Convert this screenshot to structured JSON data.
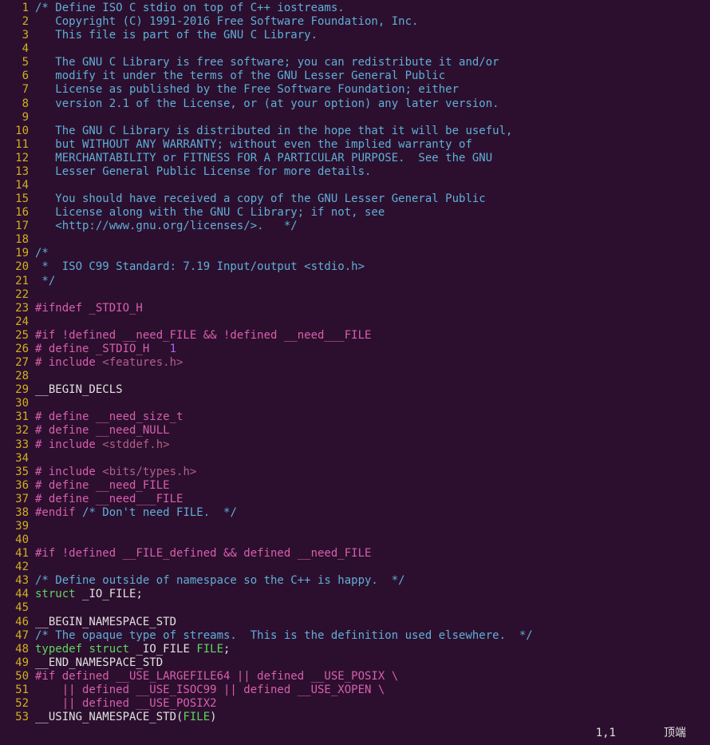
{
  "status": {
    "pos": "1,1",
    "mode": "顶端"
  },
  "lines": [
    {
      "n": 1,
      "segs": [
        [
          "c-comment",
          "/* Define ISO C stdio on top of C++ iostreams."
        ]
      ]
    },
    {
      "n": 2,
      "segs": [
        [
          "c-comment",
          "   Copyright (C) 1991-2016 Free Software Foundation, Inc."
        ]
      ]
    },
    {
      "n": 3,
      "segs": [
        [
          "c-comment",
          "   This file is part of the GNU C Library."
        ]
      ]
    },
    {
      "n": 4,
      "segs": [
        [
          "",
          ""
        ]
      ]
    },
    {
      "n": 5,
      "segs": [
        [
          "c-comment",
          "   The GNU C Library is free software; you can redistribute it and/or"
        ]
      ]
    },
    {
      "n": 6,
      "segs": [
        [
          "c-comment",
          "   modify it under the terms of the GNU Lesser General Public"
        ]
      ]
    },
    {
      "n": 7,
      "segs": [
        [
          "c-comment",
          "   License as published by the Free Software Foundation; either"
        ]
      ]
    },
    {
      "n": 8,
      "segs": [
        [
          "c-comment",
          "   version 2.1 of the License, or (at your option) any later version."
        ]
      ]
    },
    {
      "n": 9,
      "segs": [
        [
          "",
          ""
        ]
      ]
    },
    {
      "n": 10,
      "segs": [
        [
          "c-comment",
          "   The GNU C Library is distributed in the hope that it will be useful,"
        ]
      ]
    },
    {
      "n": 11,
      "segs": [
        [
          "c-comment",
          "   but WITHOUT ANY WARRANTY; without even the implied warranty of"
        ]
      ]
    },
    {
      "n": 12,
      "segs": [
        [
          "c-comment",
          "   MERCHANTABILITY or FITNESS FOR A PARTICULAR PURPOSE.  See the GNU"
        ]
      ]
    },
    {
      "n": 13,
      "segs": [
        [
          "c-comment",
          "   Lesser General Public License for more details."
        ]
      ]
    },
    {
      "n": 14,
      "segs": [
        [
          "",
          ""
        ]
      ]
    },
    {
      "n": 15,
      "segs": [
        [
          "c-comment",
          "   You should have received a copy of the GNU Lesser General Public"
        ]
      ]
    },
    {
      "n": 16,
      "segs": [
        [
          "c-comment",
          "   License along with the GNU C Library; if not, see"
        ]
      ]
    },
    {
      "n": 17,
      "segs": [
        [
          "c-comment",
          "   <http://www.gnu.org/licenses/>.   */"
        ]
      ]
    },
    {
      "n": 18,
      "segs": [
        [
          "",
          ""
        ]
      ]
    },
    {
      "n": 19,
      "segs": [
        [
          "c-comment",
          "/*"
        ]
      ]
    },
    {
      "n": 20,
      "segs": [
        [
          "c-comment",
          " *  ISO C99 Standard: 7.19 Input/output <stdio.h>"
        ]
      ]
    },
    {
      "n": 21,
      "segs": [
        [
          "c-comment",
          " */"
        ]
      ]
    },
    {
      "n": 22,
      "segs": [
        [
          "",
          ""
        ]
      ]
    },
    {
      "n": 23,
      "segs": [
        [
          "c-preproc",
          "#ifndef _STDIO_H"
        ]
      ]
    },
    {
      "n": 24,
      "segs": [
        [
          "",
          ""
        ]
      ]
    },
    {
      "n": 25,
      "segs": [
        [
          "c-preproc",
          "#if !defined __need_FILE && !defined __need___FILE"
        ]
      ]
    },
    {
      "n": 26,
      "segs": [
        [
          "c-preproc",
          "# define _STDIO_H   "
        ],
        [
          "c-number",
          "1"
        ]
      ]
    },
    {
      "n": 27,
      "segs": [
        [
          "c-preproc",
          "# include "
        ],
        [
          "c-include",
          "<features.h>"
        ]
      ]
    },
    {
      "n": 28,
      "segs": [
        [
          "",
          ""
        ]
      ]
    },
    {
      "n": 29,
      "segs": [
        [
          "c-ident",
          "__BEGIN_DECLS"
        ]
      ]
    },
    {
      "n": 30,
      "segs": [
        [
          "",
          ""
        ]
      ]
    },
    {
      "n": 31,
      "segs": [
        [
          "c-preproc",
          "# define __need_size_t"
        ]
      ]
    },
    {
      "n": 32,
      "segs": [
        [
          "c-preproc",
          "# define __need_NULL"
        ]
      ]
    },
    {
      "n": 33,
      "segs": [
        [
          "c-preproc",
          "# include "
        ],
        [
          "c-include",
          "<stddef.h>"
        ]
      ]
    },
    {
      "n": 34,
      "segs": [
        [
          "",
          ""
        ]
      ]
    },
    {
      "n": 35,
      "segs": [
        [
          "c-preproc",
          "# include "
        ],
        [
          "c-include",
          "<bits/types.h>"
        ]
      ]
    },
    {
      "n": 36,
      "segs": [
        [
          "c-preproc",
          "# define __need_FILE"
        ]
      ]
    },
    {
      "n": 37,
      "segs": [
        [
          "c-preproc",
          "# define __need___FILE"
        ]
      ]
    },
    {
      "n": 38,
      "segs": [
        [
          "c-preproc",
          "#endif "
        ],
        [
          "c-comment",
          "/* Don't need FILE.  */"
        ]
      ]
    },
    {
      "n": 39,
      "segs": [
        [
          "",
          ""
        ]
      ]
    },
    {
      "n": 40,
      "segs": [
        [
          "",
          ""
        ]
      ]
    },
    {
      "n": 41,
      "segs": [
        [
          "c-preproc",
          "#if !defined __FILE_defined && defined __need_FILE"
        ]
      ]
    },
    {
      "n": 42,
      "segs": [
        [
          "",
          ""
        ]
      ]
    },
    {
      "n": 43,
      "segs": [
        [
          "c-comment",
          "/* Define outside of namespace so the C++ is happy.  */"
        ]
      ]
    },
    {
      "n": 44,
      "segs": [
        [
          "c-keyword",
          "struct"
        ],
        [
          "",
          " "
        ],
        [
          "c-ident",
          "_IO_FILE"
        ],
        [
          "c-ident",
          ";"
        ]
      ]
    },
    {
      "n": 45,
      "segs": [
        [
          "",
          ""
        ]
      ]
    },
    {
      "n": 46,
      "segs": [
        [
          "c-ident",
          "__BEGIN_NAMESPACE_STD"
        ]
      ]
    },
    {
      "n": 47,
      "segs": [
        [
          "c-comment",
          "/* The opaque type of streams.  This is the definition used elsewhere.  */"
        ]
      ]
    },
    {
      "n": 48,
      "segs": [
        [
          "c-keyword",
          "typedef"
        ],
        [
          "",
          " "
        ],
        [
          "c-keyword",
          "struct"
        ],
        [
          "",
          " "
        ],
        [
          "c-ident",
          "_IO_FILE "
        ],
        [
          "c-type",
          "FILE"
        ],
        [
          "c-ident",
          ";"
        ]
      ]
    },
    {
      "n": 49,
      "segs": [
        [
          "c-ident",
          "__END_NAMESPACE_STD"
        ]
      ]
    },
    {
      "n": 50,
      "segs": [
        [
          "c-preproc",
          "#if defined __USE_LARGEFILE64 || defined __USE_POSIX \\"
        ]
      ]
    },
    {
      "n": 51,
      "segs": [
        [
          "c-preproc",
          "    || defined __USE_ISOC99 || defined __USE_XOPEN \\"
        ]
      ]
    },
    {
      "n": 52,
      "segs": [
        [
          "c-preproc",
          "    || defined __USE_POSIX2"
        ]
      ]
    },
    {
      "n": 53,
      "segs": [
        [
          "c-ident",
          "__USING_NAMESPACE_STD("
        ],
        [
          "c-type",
          "FILE"
        ],
        [
          "c-ident",
          ")"
        ]
      ]
    }
  ]
}
